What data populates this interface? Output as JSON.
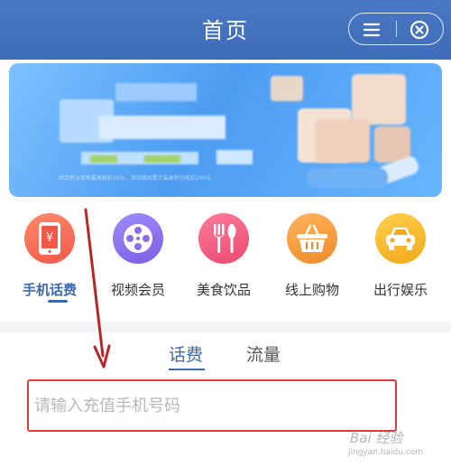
{
  "header": {
    "title": "首页",
    "menu_icon": "menu-icon",
    "close_icon": "close-circle-icon"
  },
  "banner": {
    "small_text": "综合积分单笔最高抵扣10元，活动期间累计最高积分抵扣200元"
  },
  "categories": [
    {
      "label": "手机话费",
      "icon": "phone-bill-icon",
      "color": "#f06a4c",
      "active": true
    },
    {
      "label": "视频会员",
      "icon": "film-reel-icon",
      "color": "#8a6ee8",
      "active": false
    },
    {
      "label": "美食饮品",
      "icon": "fork-knife-icon",
      "color": "#f0547a",
      "active": false
    },
    {
      "label": "线上购物",
      "icon": "shopping-basket-icon",
      "color": "#f79a3a",
      "active": false
    },
    {
      "label": "出行娱乐",
      "icon": "car-icon",
      "color": "#f5b72c",
      "active": false
    }
  ],
  "tabs": [
    {
      "label": "话费",
      "active": true
    },
    {
      "label": "流量",
      "active": false
    }
  ],
  "phone_input": {
    "placeholder": "请输入充值手机号码",
    "value": ""
  },
  "watermark": {
    "text": "Bai 经验",
    "url": "jingyan.baidu.com"
  },
  "colors": {
    "header": "#4a78c4",
    "accent": "#3d68b3",
    "highlight_box": "#e23b3b",
    "annotation_arrow": "#b62828"
  }
}
